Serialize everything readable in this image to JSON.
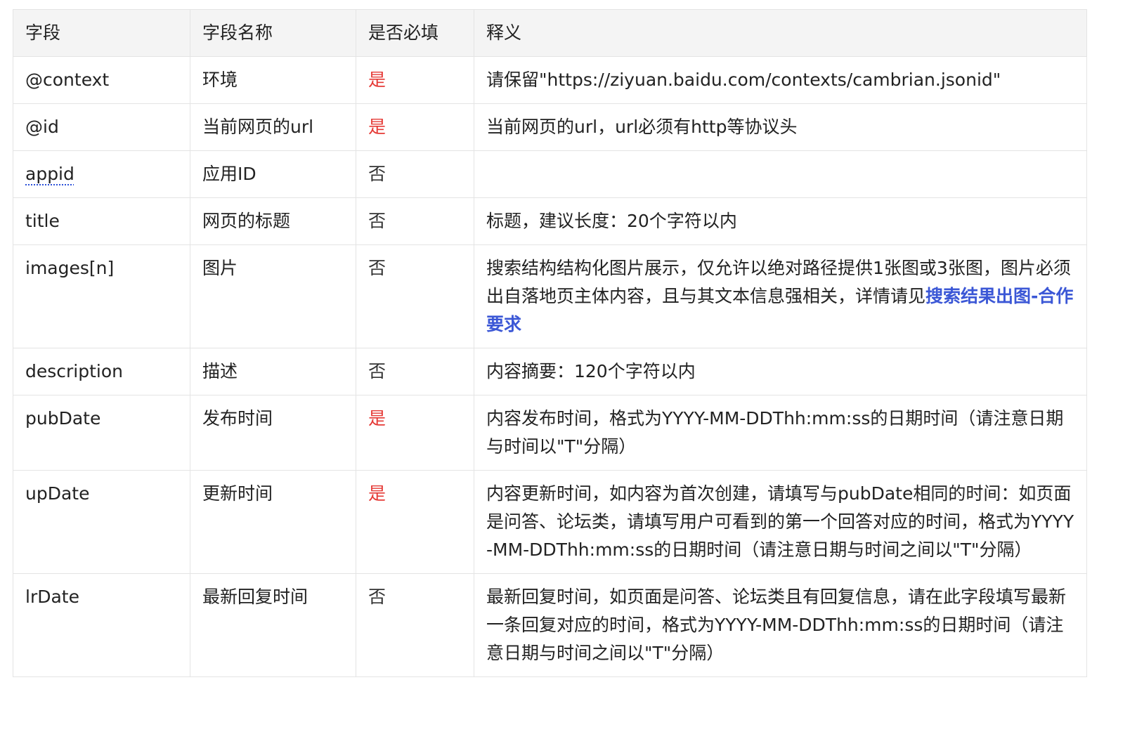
{
  "table": {
    "headers": {
      "field": "字段",
      "name": "字段名称",
      "required": "是否必填",
      "desc": "释义"
    },
    "rows": [
      {
        "field": "@context",
        "name": "环境",
        "required": "是",
        "desc": "请保留\"https://ziyuan.baidu.com/contexts/cambrian.jsonid\""
      },
      {
        "field": "@id",
        "name": "当前网页的url",
        "required": "是",
        "desc": "当前网页的url，url必须有http等协议头"
      },
      {
        "field": "appid",
        "name": "应用ID",
        "required": "否",
        "desc": ""
      },
      {
        "field": "title",
        "name": "网页的标题",
        "required": "否",
        "desc": "标题，建议长度：20个字符以内"
      },
      {
        "field": "images[n]",
        "name": "图片",
        "required": "否",
        "desc": "搜索结构结构化图片展示，仅允许以绝对路径提供1张图或3张图，图片必须出自落地页主体内容，且与其文本信息强相关，详情请见",
        "link": "搜索结果出图-合作要求"
      },
      {
        "field": "description",
        "name": "描述",
        "required": "否",
        "desc": "内容摘要：120个字符以内"
      },
      {
        "field": "pubDate",
        "name": "发布时间",
        "required": "是",
        "desc": "内容发布时间，格式为YYYY-MM-DDThh:mm:ss的日期时间（请注意日期与时间以\"T\"分隔）"
      },
      {
        "field": "upDate",
        "name": "更新时间",
        "required": "是",
        "desc": "内容更新时间，如内容为首次创建，请填写与pubDate相同的时间：如页面是问答、论坛类，请填写用户可看到的第一个回答对应的时间，格式为YYYY-MM-DDThh:mm:ss的日期时间（请注意日期与时间之间以\"T\"分隔）"
      },
      {
        "field": "lrDate",
        "name": "最新回复时间",
        "required": "否",
        "desc": "最新回复时间，如页面是问答、论坛类且有回复信息，请在此字段填写最新一条回复对应的时间，格式为YYYY-MM-DDThh:mm:ss的日期时间（请注意日期与时间之间以\"T\"分隔）"
      }
    ]
  },
  "colors": {
    "required_yes": "#e53935",
    "link": "#3b57d6",
    "header_bg": "#f4f4f4",
    "border": "#e4e4e4"
  }
}
